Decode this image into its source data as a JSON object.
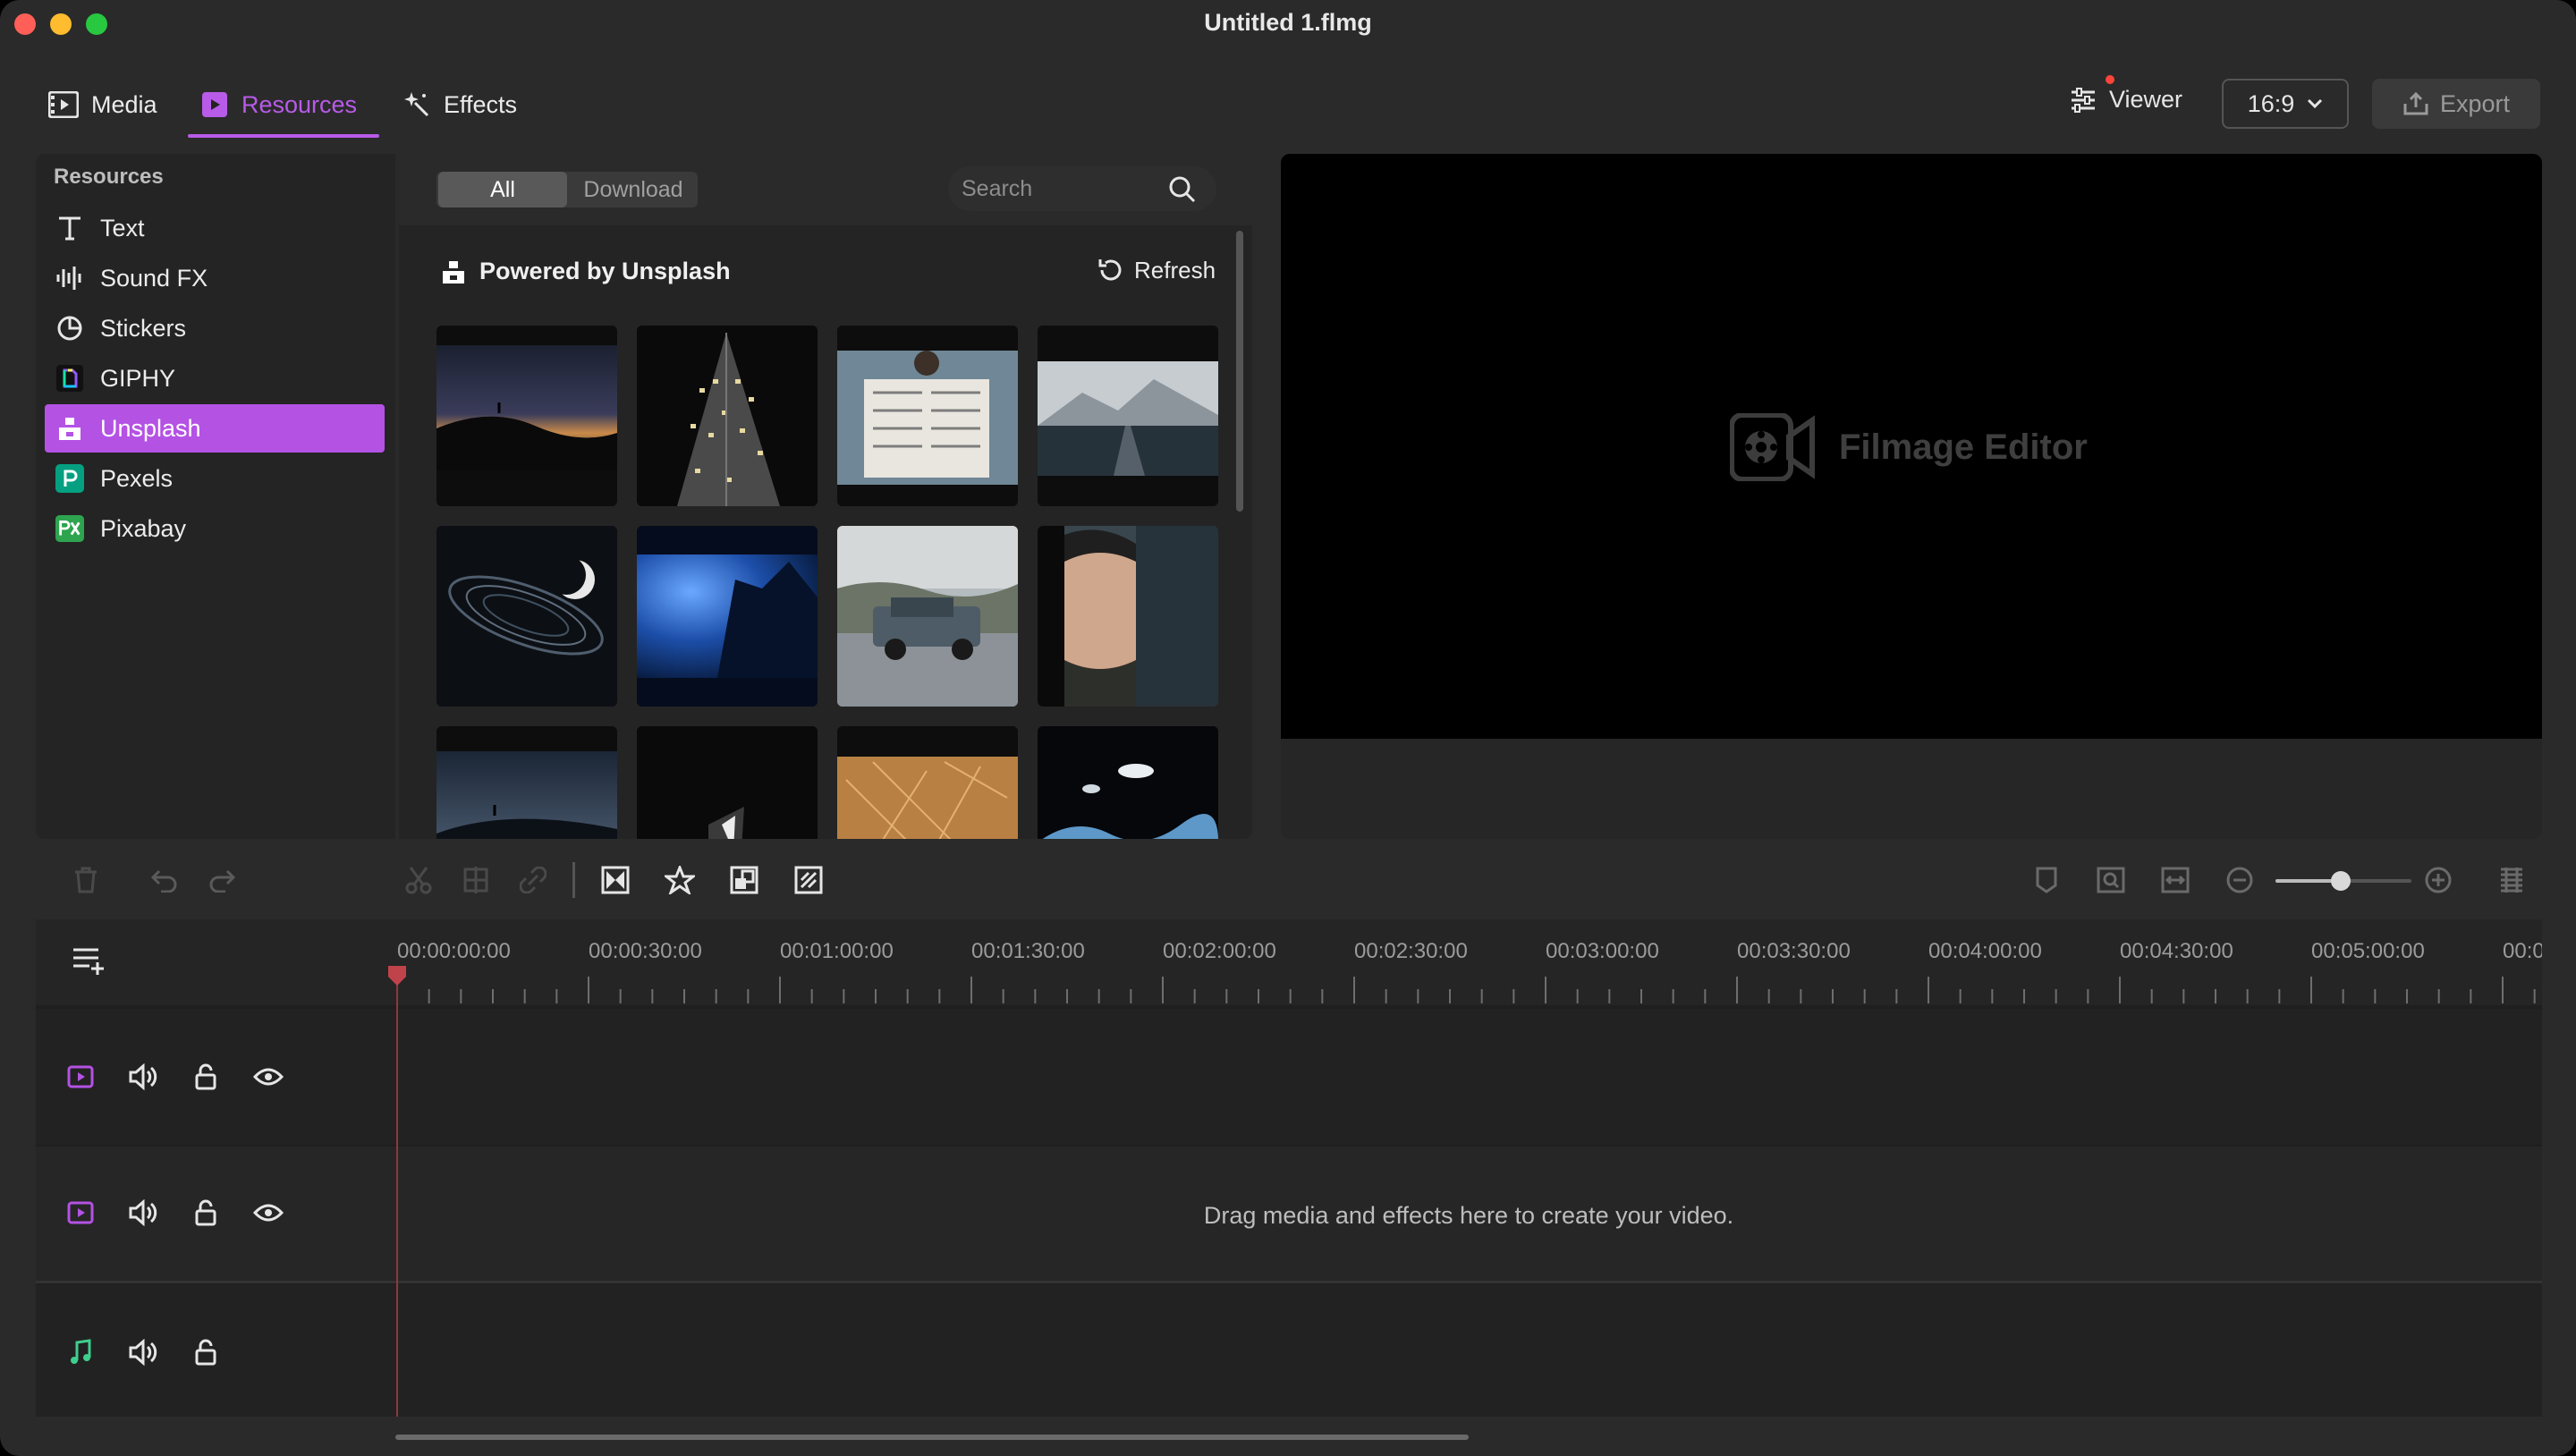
{
  "window": {
    "title": "Untitled 1.flmg"
  },
  "top_tabs": [
    {
      "label": "Media",
      "icon": "film-icon",
      "active": false
    },
    {
      "label": "Resources",
      "icon": "resources-icon",
      "active": true
    },
    {
      "label": "Effects",
      "icon": "sparkle-wand-icon",
      "active": false
    }
  ],
  "top_right": {
    "viewer_label": "Viewer",
    "aspect_ratio": "16:9",
    "export_label": "Export"
  },
  "sidebar": {
    "heading": "Resources",
    "items": [
      {
        "label": "Text",
        "icon": "text-icon",
        "active": false
      },
      {
        "label": "Sound FX",
        "icon": "waveform-icon",
        "active": false
      },
      {
        "label": "Stickers",
        "icon": "sticker-icon",
        "active": false
      },
      {
        "label": "GIPHY",
        "icon": "giphy-icon",
        "active": false
      },
      {
        "label": "Unsplash",
        "icon": "unsplash-icon",
        "active": true
      },
      {
        "label": "Pexels",
        "icon": "pexels-icon",
        "active": false
      },
      {
        "label": "Pixabay",
        "icon": "pixabay-icon",
        "active": false
      }
    ]
  },
  "library": {
    "filters": [
      "All",
      "Download"
    ],
    "active_filter": "All",
    "search_placeholder": "Search",
    "source_label": "Powered by Unsplash",
    "refresh_label": "Refresh"
  },
  "viewer": {
    "watermark": "Filmage Editor"
  },
  "timeline": {
    "ruler_labels": [
      "00:00:00:00",
      "00:00:30:00",
      "00:01:00:00",
      "00:01:30:00",
      "00:02:00:00",
      "00:02:30:00",
      "00:03:00:00",
      "00:03:30:00",
      "00:04:00:00",
      "00:04:30:00",
      "00:05:00:00",
      "00:0"
    ],
    "drop_hint": "Drag media and effects here to create your video."
  },
  "colors": {
    "accent": "#b452e4",
    "audio_accent": "#3ecf8e",
    "playhead": "#c0434b"
  }
}
